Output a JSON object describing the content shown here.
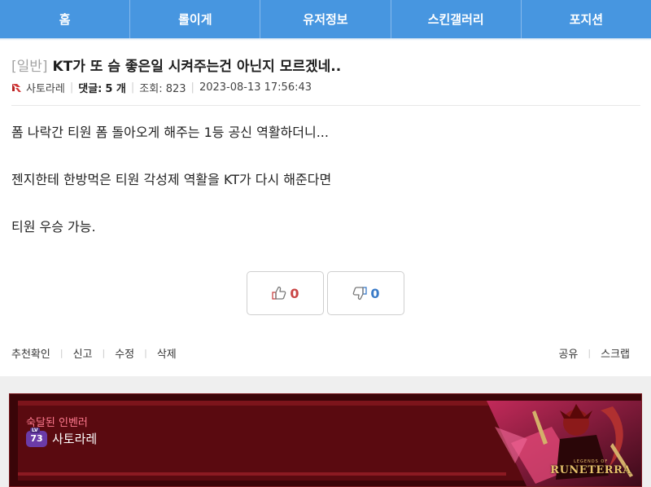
{
  "nav": {
    "items": [
      "홈",
      "롤이게",
      "유저정보",
      "스킨갤러리",
      "포지션"
    ]
  },
  "post": {
    "category": "[일반]",
    "title": "KT가 또 슴 좋은일 시켜주는건 아닌지 모르겠네..",
    "author": "사토라레",
    "comments_label": "댓글:",
    "comments_count": "5 개",
    "views": "조회: 823",
    "datetime": "2023-08-13 17:56:43",
    "body": [
      "폼 나락간 티원 폼 돌아오게 해주는 1등 공신 역활하더니...",
      "젠지한테 한방먹은 티원 각성제 역활을 KT가 다시 해준다면",
      "티원 우승 가능."
    ]
  },
  "votes": {
    "up_count": "0",
    "down_count": "0",
    "up_color": "#c94545",
    "down_color": "#3a7bc8"
  },
  "actions": {
    "left": [
      "추천확인",
      "신고",
      "수정",
      "삭제"
    ],
    "right": [
      "공유",
      "스크랩"
    ]
  },
  "banner": {
    "label": "숙달된 인벤러",
    "level_tag": "LV",
    "level": "73",
    "user": "사토라레",
    "logo_small": "LEGENDS OF",
    "logo_big": "RUNETERRA"
  },
  "colors": {
    "nav_bg": "#4796e0",
    "banner_bg": "#3a0508",
    "badge_label": "#ff7a8f"
  }
}
